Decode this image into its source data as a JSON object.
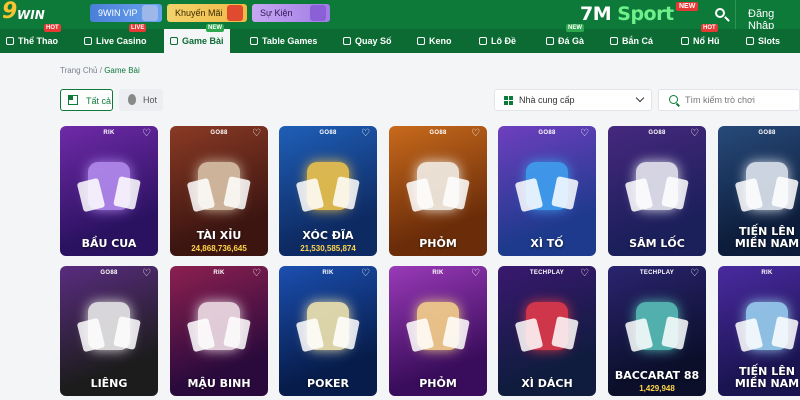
{
  "header": {
    "logo_main": "9",
    "logo_sub": "WIN",
    "pills": [
      {
        "label": "9WIN VIP",
        "icon": "diamond-icon"
      },
      {
        "label": "Khuyến Mãi",
        "icon": "gift-icon"
      },
      {
        "label": "Sự Kiện",
        "icon": "box-icon"
      }
    ],
    "partner_prefix": "7M",
    "partner_suffix": "Sport",
    "partner_tag": "NEW",
    "login_label": "Đăng Nhập"
  },
  "nav": {
    "items": [
      {
        "label": "Thể Thao",
        "badge": "HOT",
        "icon": "sports-icon"
      },
      {
        "label": "Live Casino",
        "badge": "LIVE",
        "icon": "live-icon"
      },
      {
        "label": "Game Bài",
        "badge": "NEW",
        "icon": "card-icon",
        "active": true
      },
      {
        "label": "Table Games",
        "badge": "",
        "icon": "table-icon"
      },
      {
        "label": "Quay Số",
        "badge": "",
        "icon": "lottery-icon"
      },
      {
        "label": "Keno",
        "badge": "",
        "icon": "keno-icon"
      },
      {
        "label": "Lô Đề",
        "badge": "",
        "icon": "number-icon"
      },
      {
        "label": "Đá Gà",
        "badge": "NEW",
        "icon": "rooster-icon"
      },
      {
        "label": "Bắn Cá",
        "badge": "",
        "icon": "fish-icon"
      },
      {
        "label": "Nổ Hũ",
        "badge": "HOT",
        "icon": "jar-icon"
      },
      {
        "label": "Slots",
        "badge": "",
        "icon": "slots-icon"
      }
    ]
  },
  "breadcrumb": {
    "home": "Trang Chủ",
    "separator": "/",
    "current": "Game Bài"
  },
  "filters": {
    "all_label": "Tất cả",
    "hot_label": "Hot"
  },
  "provider_select": {
    "label": "Nhà cung cấp"
  },
  "game_search": {
    "placeholder": "Tìm kiếm trò chơi"
  },
  "games": [
    {
      "name": "BẦU CUA",
      "provider": "RIK",
      "jackpot": "",
      "color1": "#2a1260",
      "color2": "#6f2aa8",
      "art": "#b48cf0"
    },
    {
      "name": "TÀI XỈU",
      "provider": "GO88",
      "jackpot": "24,868,736,645",
      "color1": "#3c1511",
      "color2": "#8a3a24",
      "art": "#d9c3a8"
    },
    {
      "name": "XÓC ĐĨA",
      "provider": "GO88",
      "jackpot": "21,530,585,874",
      "color1": "#0e2a62",
      "color2": "#1f5fb8",
      "art": "#f0c44a"
    },
    {
      "name": "PHỎM",
      "provider": "GO88",
      "jackpot": "",
      "color1": "#6a2c09",
      "color2": "#c86a1c",
      "art": "#f4f0e8"
    },
    {
      "name": "XÌ TỐ",
      "provider": "GO88",
      "jackpot": "",
      "color1": "#1d3a8c",
      "color2": "#6f3fbf",
      "art": "#3fa0f0"
    },
    {
      "name": "SÂM LỐC",
      "provider": "GO88",
      "jackpot": "",
      "color1": "#1b1f5a",
      "color2": "#46287e",
      "art": "#e8e8f0"
    },
    {
      "name": "TIẾN LÊN MIỀN NAM",
      "provider": "GO88",
      "jackpot": "",
      "color1": "#0c1c3a",
      "color2": "#274a7a",
      "art": "#dfe6ef"
    },
    {
      "name": "LIÊNG",
      "provider": "GO88",
      "jackpot": "",
      "color1": "#1c1c1c",
      "color2": "#5a2c80",
      "art": "#eaeaea"
    },
    {
      "name": "MẬU BINH",
      "provider": "RIK",
      "jackpot": "",
      "color1": "#2a0a3c",
      "color2": "#8c2050",
      "art": "#f0e0e8"
    },
    {
      "name": "POKER",
      "provider": "RIK",
      "jackpot": "",
      "color1": "#071c4a",
      "color2": "#1b4fb0",
      "art": "#f2e6b0"
    },
    {
      "name": "PHỎM",
      "provider": "RIK",
      "jackpot": "",
      "color1": "#3a0d5c",
      "color2": "#9a3ab8",
      "art": "#f6d28a"
    },
    {
      "name": "XÌ DÁCH",
      "provider": "TECHPLAY",
      "jackpot": "",
      "color1": "#0f1c3e",
      "color2": "#3a1870",
      "art": "#e23a4a"
    },
    {
      "name": "BACCARAT 88",
      "provider": "TECHPLAY",
      "jackpot": "1,429,948",
      "color1": "#0b0f2a",
      "color2": "#2a2470",
      "art": "#58c0b8"
    },
    {
      "name": "TIẾN LÊN MIỀN NAM",
      "provider": "RIK",
      "jackpot": "",
      "color1": "#1a1450",
      "color2": "#4a2aa0",
      "art": "#9ad0f0"
    }
  ]
}
